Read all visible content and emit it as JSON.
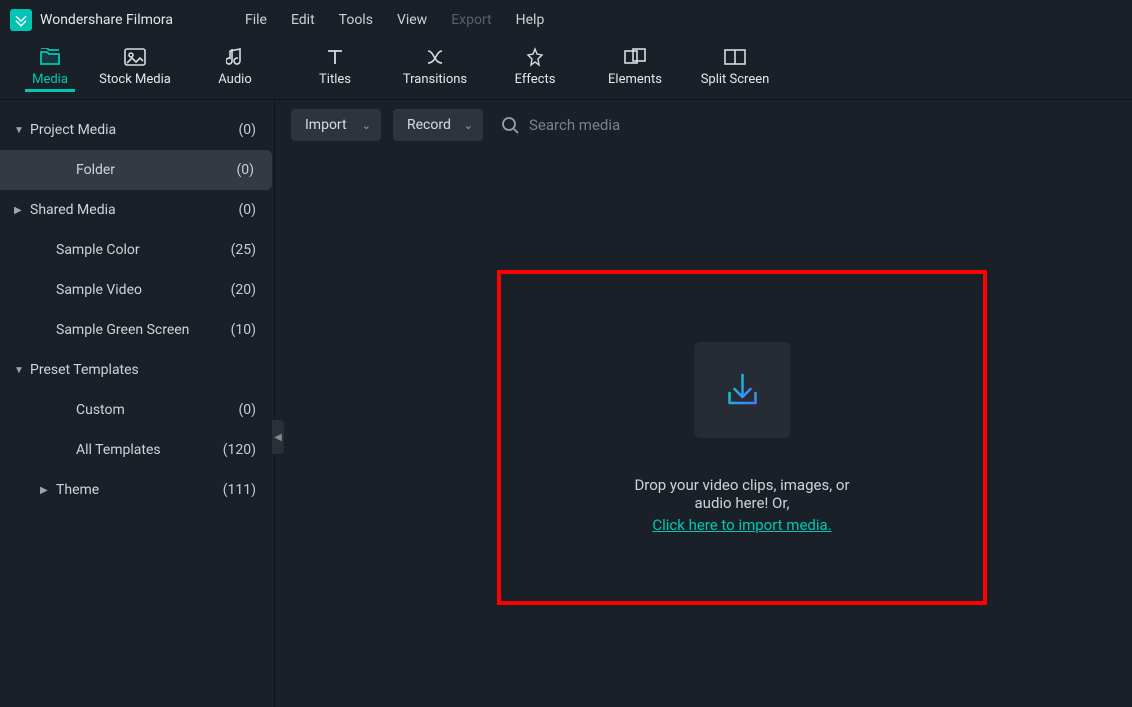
{
  "app": {
    "title": "Wondershare Filmora"
  },
  "menu": {
    "file": "File",
    "edit": "Edit",
    "tools": "Tools",
    "view": "View",
    "export": "Export",
    "help": "Help"
  },
  "tabs": {
    "media": "Media",
    "stock_media": "Stock Media",
    "audio": "Audio",
    "titles": "Titles",
    "transitions": "Transitions",
    "effects": "Effects",
    "elements": "Elements",
    "split_screen": "Split Screen"
  },
  "sidebar": {
    "project_media": {
      "label": "Project Media",
      "count": "(0)"
    },
    "folder": {
      "label": "Folder",
      "count": "(0)"
    },
    "shared_media": {
      "label": "Shared Media",
      "count": "(0)"
    },
    "sample_color": {
      "label": "Sample Color",
      "count": "(25)"
    },
    "sample_video": {
      "label": "Sample Video",
      "count": "(20)"
    },
    "sample_green": {
      "label": "Sample Green Screen",
      "count": "(10)"
    },
    "preset_templates": {
      "label": "Preset Templates"
    },
    "custom": {
      "label": "Custom",
      "count": "(0)"
    },
    "all_templates": {
      "label": "All Templates",
      "count": "(120)"
    },
    "theme": {
      "label": "Theme",
      "count": "(111)"
    }
  },
  "content_top": {
    "import": "Import",
    "record": "Record",
    "search_placeholder": "Search media"
  },
  "drop_zone": {
    "text": "Drop your video clips, images, or audio here! Or,",
    "link": "Click here to import media."
  }
}
